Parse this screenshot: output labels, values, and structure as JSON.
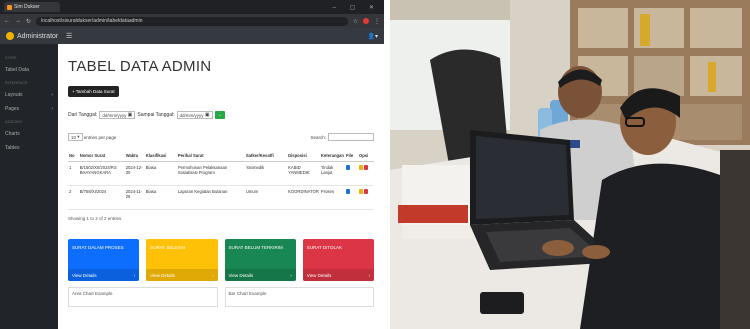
{
  "browser": {
    "tab_title": "Sim Dukser",
    "url": "localhost/sisuratdukser/admin/tabeldataadmin"
  },
  "app": {
    "brand": "Administrator",
    "user_icon": "user-icon"
  },
  "sidebar": {
    "sections": [
      {
        "heading": "CORE",
        "items": [
          "Tabel Data"
        ]
      },
      {
        "heading": "INTERFACE",
        "items": [
          "Layouts",
          "Pages"
        ]
      },
      {
        "heading": "ADDONS",
        "items": [
          "Charts",
          "Tables"
        ]
      }
    ]
  },
  "main": {
    "title": "TABEL DATA ADMIN",
    "add_button": "+ Tambah Data Surat",
    "filter": {
      "from_label": "Dari Tanggal:",
      "from_value": "dd/mm/yyyy",
      "to_label": "Sampai Tanggal:",
      "to_value": "dd/mm/yyyy",
      "go": "→"
    },
    "entries_select": "10",
    "entries_label": "entries per page",
    "search_label": "Search:",
    "table": {
      "headers": [
        "No",
        "Nomor Surat",
        "Waktu",
        "Klasifikasi",
        "Perihal Surat",
        "Satker/Kesatfi",
        "Disposisi",
        "Keterangan",
        "File",
        "Opsi"
      ],
      "rows": [
        [
          "1",
          "B/1502/XII/2024/RS BHAYANGKARA",
          "2024-12-30",
          "Biasa",
          "Permohonan Pelaksanaan Sosialisasi Program",
          "Yanmedik",
          "KABID YANMEDIK",
          "Tindak Lanjut",
          "",
          ""
        ],
        [
          "2",
          "B/758/XI/2024",
          "2024-11-26",
          "Biasa",
          "Laporan Kegiatan Bulanan",
          "Umum",
          "KOORDINATOR",
          "Proses",
          "",
          ""
        ]
      ]
    },
    "showing": "Showing 1 to 2 of 2 entries",
    "cards": [
      {
        "title": "SURAT DALAM PROSES",
        "link": "View Details",
        "color": "#0d6efd"
      },
      {
        "title": "SURAT SELESAI",
        "link": "View Details",
        "color": "#ffc107"
      },
      {
        "title": "SURAT BELUM TERKIRIM",
        "link": "View Details",
        "color": "#198754"
      },
      {
        "title": "SURAT DITOLAK",
        "link": "View Details",
        "color": "#dc3545"
      }
    ],
    "bottom_cards": [
      "Area Chart Example",
      "Bar Chart Example"
    ]
  }
}
